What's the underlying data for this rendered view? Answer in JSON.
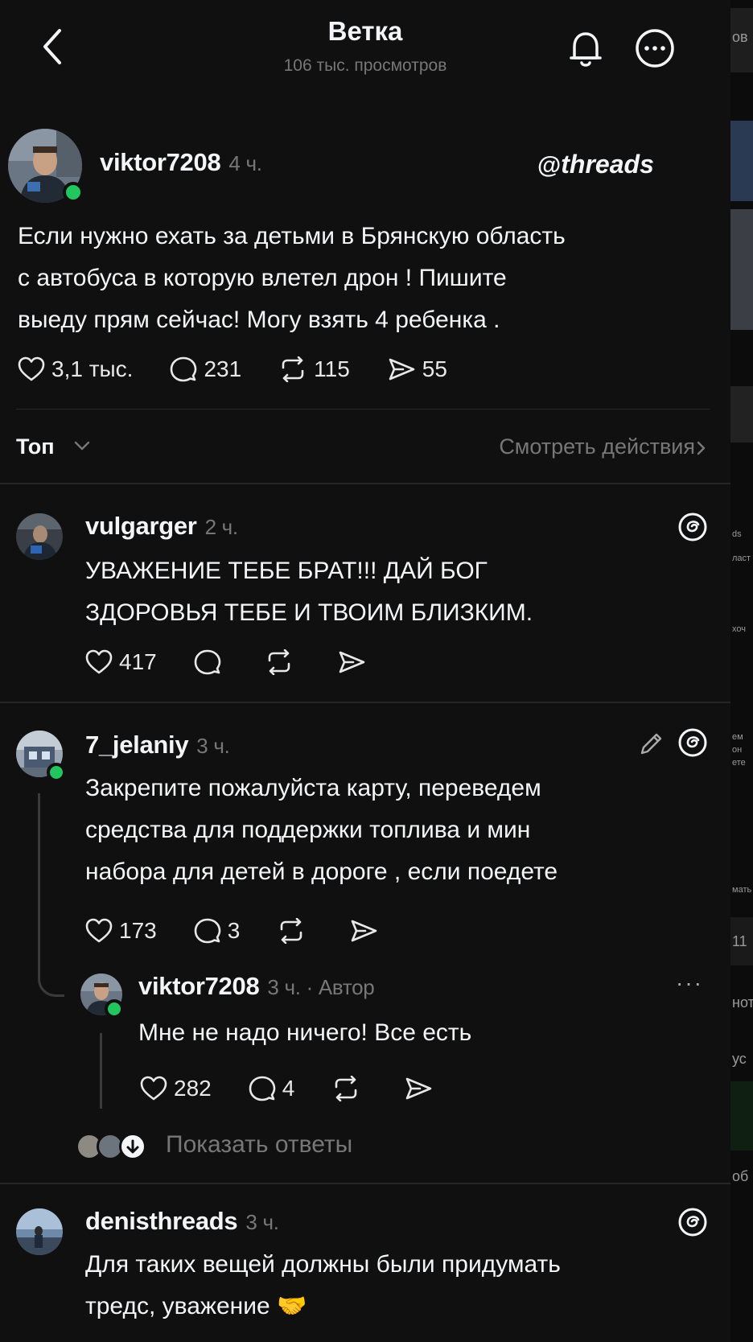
{
  "header": {
    "title": "Ветка",
    "subtitle": "106 тыс. просмотров"
  },
  "post": {
    "username": "viktor7208",
    "time": "4 ч.",
    "brand": "threads",
    "lines": [
      "Если нужно ехать за детьми в Брянскую область",
      "с автобуса в которую влетел дрон ! Пишите",
      "выеду прям сейчас! Могу взять 4 ребенка ."
    ],
    "likes": "3,1 тыс.",
    "comments": "231",
    "reposts": "115",
    "shares": "55"
  },
  "sort": {
    "label": "Топ",
    "view_activity": "Смотреть действия"
  },
  "replies": [
    {
      "username": "vulgarger",
      "time": "2 ч.",
      "lines": [
        "УВАЖЕНИЕ ТЕБЕ БРАТ!!! ДАЙ БОГ",
        "ЗДОРОВЬЯ ТЕБЕ И ТВОИМ БЛИЗКИМ."
      ],
      "likes": "417"
    },
    {
      "username": "7_jelaniy",
      "time": "3 ч.",
      "lines": [
        "Закрепите пожалуйста карту, переведем",
        "средства для поддержки топлива и мин",
        "набора для детей в дороге , если поедете"
      ],
      "likes": "173",
      "comments": "3"
    },
    {
      "username": "viktor7208",
      "time": "3 ч. · Автор",
      "lines": [
        "Мне не надо ничего! Все есть"
      ],
      "likes": "282",
      "comments": "4"
    },
    {
      "username": "denisthreads",
      "time": "3 ч.",
      "lines": [
        "Для таких вещей должны были придумать",
        "тредс, уважение 🤝"
      ]
    }
  ],
  "show_replies": "Показать ответы",
  "more_menu": "···",
  "side_fragments": [
    "ов",
    "ds",
    "ласт",
    "хоч",
    "ем",
    "он",
    "ете",
    "мать",
    "11",
    "нот",
    "ус",
    "об"
  ],
  "colors": {
    "background": "#101010",
    "online": "#22c55e",
    "muted": "#777777"
  }
}
